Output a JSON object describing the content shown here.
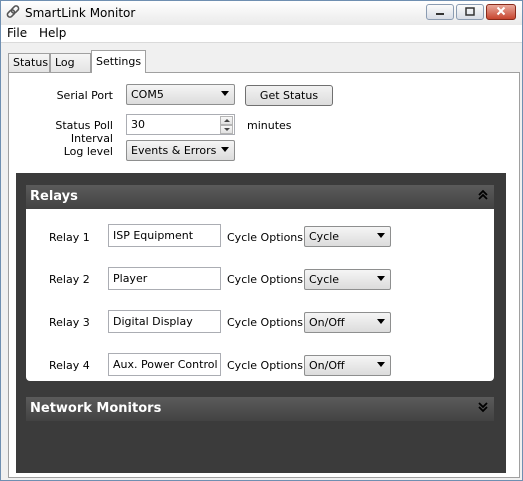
{
  "window": {
    "title": "SmartLink Monitor"
  },
  "menu": {
    "file": "File",
    "help": "Help"
  },
  "tabs": [
    "Status",
    "Log",
    "Settings"
  ],
  "settings": {
    "serial_port_label": "Serial Port",
    "serial_port_value": "COM5",
    "get_status_label": "Get Status",
    "poll_interval_label": "Status Poll Interval",
    "poll_interval_value": "30",
    "poll_interval_unit": "minutes",
    "log_level_label": "Log level",
    "log_level_value": "Events & Errors"
  },
  "relays_panel": {
    "title": "Relays",
    "cycle_options_label": "Cycle Options",
    "items": [
      {
        "label": "Relay 1",
        "name": "ISP Equipment",
        "cycle": "Cycle"
      },
      {
        "label": "Relay 2",
        "name": "Player",
        "cycle": "Cycle"
      },
      {
        "label": "Relay 3",
        "name": "Digital Display",
        "cycle": "On/Off"
      },
      {
        "label": "Relay 4",
        "name": "Aux. Power Control",
        "cycle": "On/Off"
      }
    ]
  },
  "network_panel": {
    "title": "Network Monitors"
  },
  "colors": {
    "dark_background": "#3b3b3b",
    "panel_header": "#4f4f4f"
  }
}
